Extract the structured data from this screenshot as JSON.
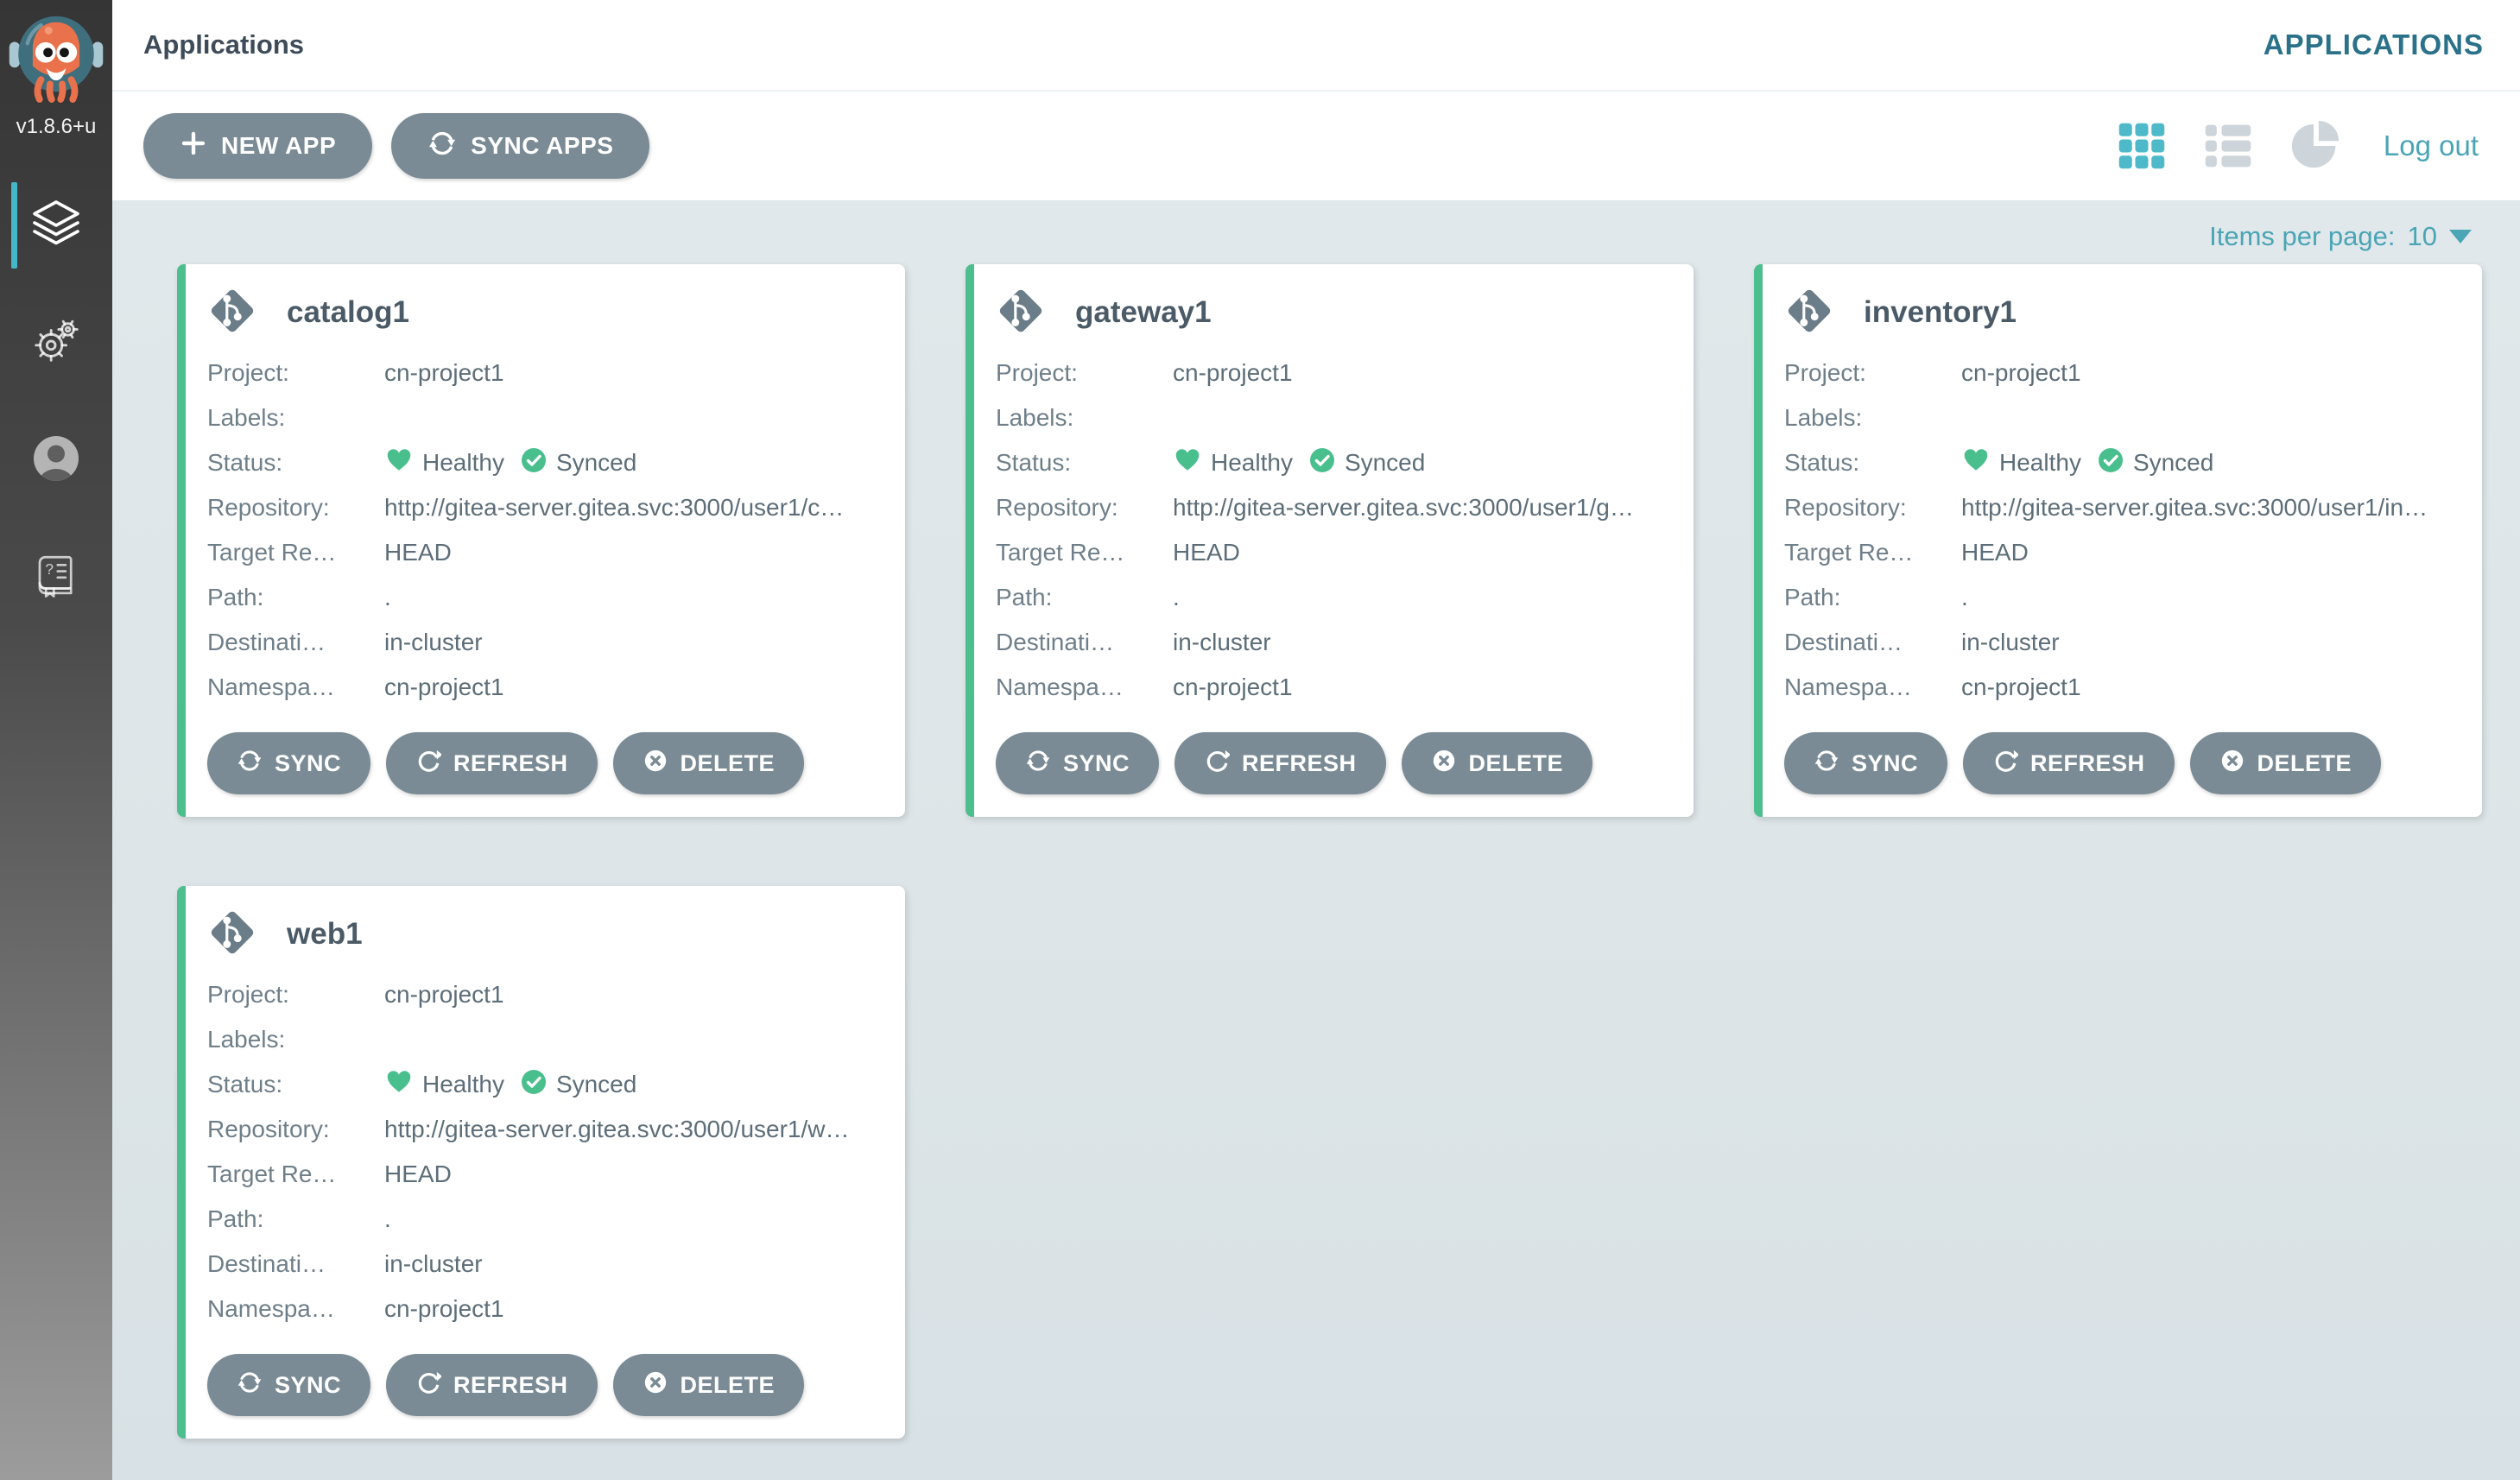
{
  "app": {
    "version": "v1.8.6+u",
    "logo_icon": "argo-octopus-logo"
  },
  "sidebar": {
    "items": [
      {
        "icon": "layers-applications-icon",
        "active": true
      },
      {
        "icon": "gear-settings-icon",
        "active": false
      },
      {
        "icon": "user-circle-icon",
        "active": false
      },
      {
        "icon": "help-book-icon",
        "active": false
      }
    ]
  },
  "header": {
    "breadcrumb": "Applications",
    "section_title": "APPLICATIONS"
  },
  "toolbar": {
    "new_app_label": "NEW APP",
    "sync_apps_label": "SYNC APPS",
    "view_toggles": [
      "grid-view-icon",
      "list-view-icon",
      "pie-summary-icon"
    ],
    "logout_label": "Log out"
  },
  "pagination": {
    "label": "Items per page:",
    "value": "10"
  },
  "card_field_labels": {
    "project": "Project:",
    "labels": "Labels:",
    "status": "Status:",
    "repository": "Repository:",
    "target_revision": "Target Re…",
    "path": "Path:",
    "destination": "Destinati…",
    "namespace": "Namespa…"
  },
  "status": {
    "health": "Healthy",
    "sync": "Synced"
  },
  "card_actions": {
    "sync": "SYNC",
    "refresh": "REFRESH",
    "delete": "DELETE"
  },
  "cards": [
    {
      "name": "catalog1",
      "project": "cn-project1",
      "labels": "",
      "repository": "http://gitea-server.gitea.svc:3000/user1/c…",
      "target_revision": "HEAD",
      "path": ".",
      "destination": "in-cluster",
      "namespace": "cn-project1"
    },
    {
      "name": "gateway1",
      "project": "cn-project1",
      "labels": "",
      "repository": "http://gitea-server.gitea.svc:3000/user1/g…",
      "target_revision": "HEAD",
      "path": ".",
      "destination": "in-cluster",
      "namespace": "cn-project1"
    },
    {
      "name": "inventory1",
      "project": "cn-project1",
      "labels": "",
      "repository": "http://gitea-server.gitea.svc:3000/user1/in…",
      "target_revision": "HEAD",
      "path": ".",
      "destination": "in-cluster",
      "namespace": "cn-project1"
    },
    {
      "name": "web1",
      "project": "cn-project1",
      "labels": "",
      "repository": "http://gitea-server.gitea.svc:3000/user1/w…",
      "target_revision": "HEAD",
      "path": ".",
      "destination": "in-cluster",
      "namespace": "cn-project1"
    }
  ],
  "colors": {
    "accent_teal": "#4aa5b5",
    "active_view_icon": "#4db9c9",
    "inactive_view_icon": "#cdd5da",
    "heading_teal": "#2a7189",
    "status_green": "#4abf8e",
    "button_slate": "#7a8b95",
    "card_border_green": "#4dbe8d",
    "nav_active_indicator": "#46b7c8"
  }
}
